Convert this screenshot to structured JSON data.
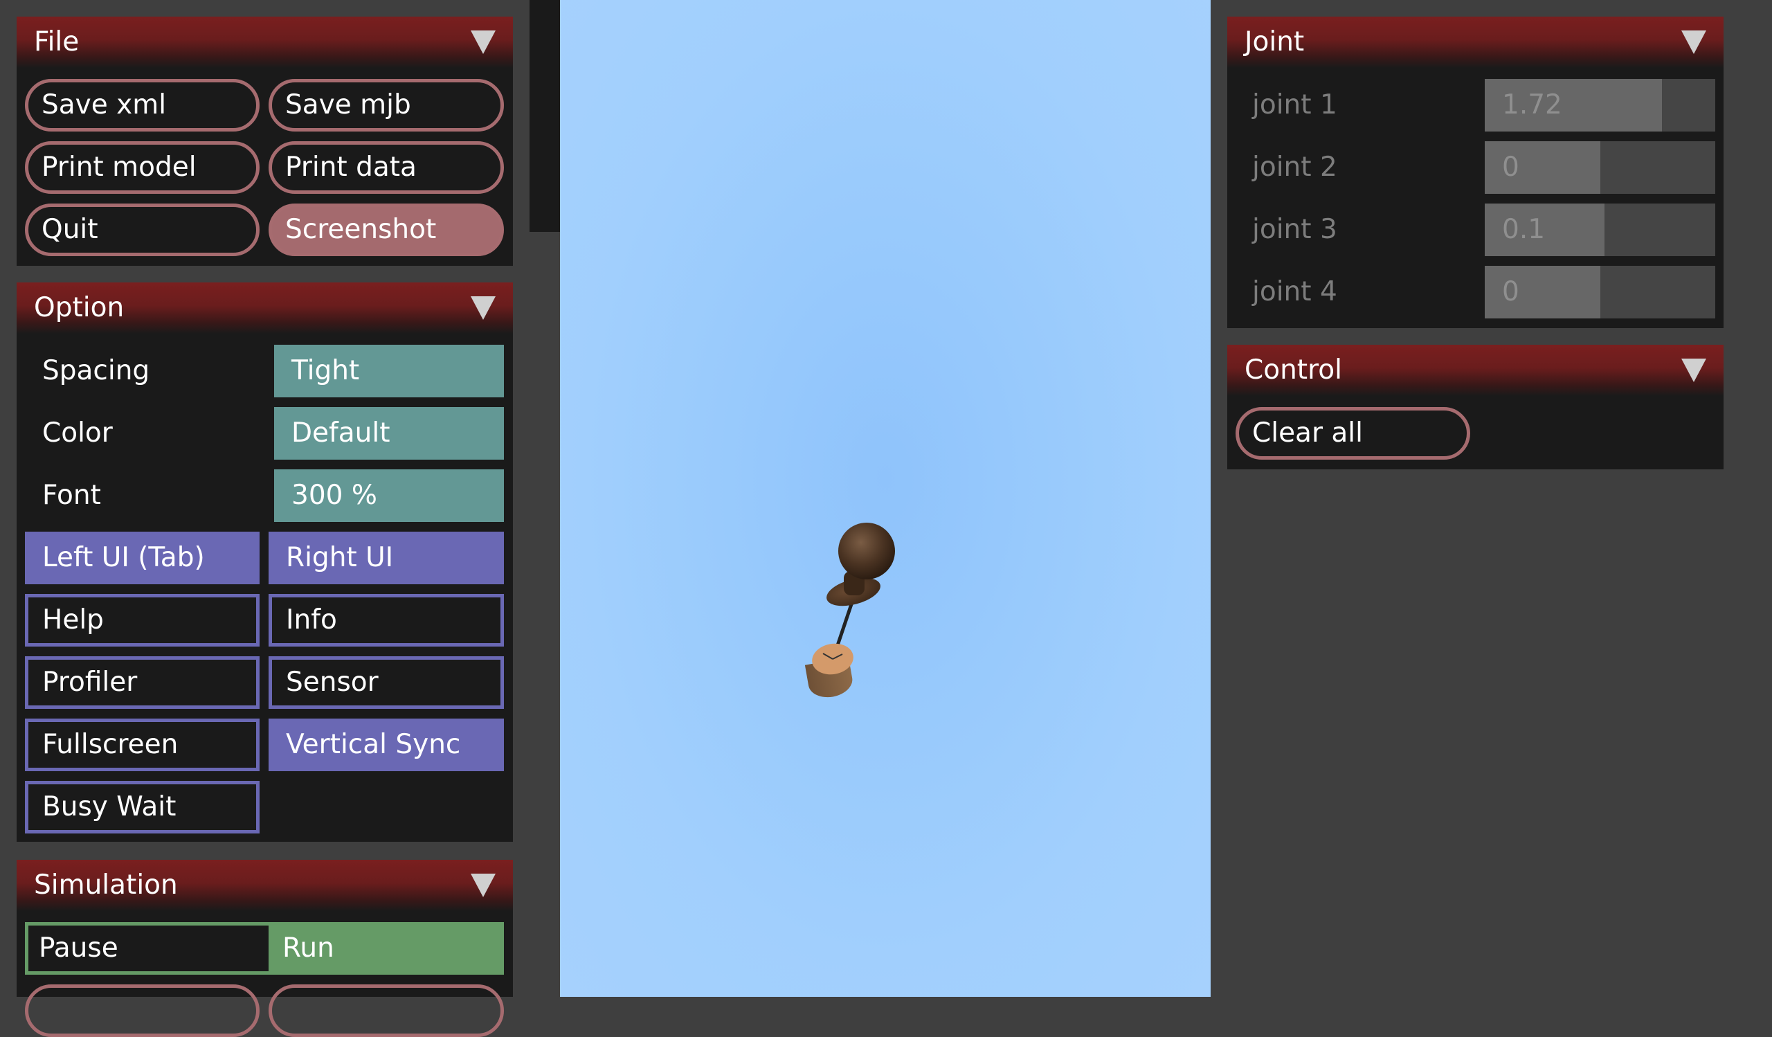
{
  "file_panel": {
    "title": "File",
    "buttons": {
      "save_xml": "Save xml",
      "save_mjb": "Save mjb",
      "print_model": "Print model",
      "print_data": "Print data",
      "quit": "Quit",
      "screenshot": "Screenshot"
    }
  },
  "option_panel": {
    "title": "Option",
    "spacing": {
      "label": "Spacing",
      "value": "Tight"
    },
    "color": {
      "label": "Color",
      "value": "Default"
    },
    "font": {
      "label": "Font",
      "value": "300 %"
    },
    "toggles": {
      "left_ui": {
        "label": "Left UI (Tab)",
        "on": true
      },
      "right_ui": {
        "label": "Right UI",
        "on": true
      },
      "help": {
        "label": "Help",
        "on": false
      },
      "info": {
        "label": "Info",
        "on": false
      },
      "profiler": {
        "label": "Profiler",
        "on": false
      },
      "sensor": {
        "label": "Sensor",
        "on": false
      },
      "fullscreen": {
        "label": "Fullscreen",
        "on": false
      },
      "vertical_sync": {
        "label": "Vertical Sync",
        "on": true
      },
      "busy_wait": {
        "label": "Busy Wait",
        "on": false
      }
    }
  },
  "simulation_panel": {
    "title": "Simulation",
    "pause": "Pause",
    "run": "Run",
    "selected": "Run"
  },
  "joint_panel": {
    "title": "Joint",
    "joints": [
      {
        "label": "joint 1",
        "value": "1.72",
        "fraction": 0.77
      },
      {
        "label": "joint 2",
        "value": "0",
        "fraction": 0.5
      },
      {
        "label": "joint 3",
        "value": "0.1",
        "fraction": 0.52
      },
      {
        "label": "joint 4",
        "value": "0",
        "fraction": 0.5
      }
    ]
  },
  "control_panel": {
    "title": "Control",
    "clear_all": "Clear all"
  },
  "colors": {
    "panel_title_red": "#7a1f1f",
    "button_outline": "#a66b6f",
    "select_teal": "#639895",
    "toggle_purple": "#6a68b4",
    "run_green": "#659b66",
    "sky": "#a1cffd"
  }
}
